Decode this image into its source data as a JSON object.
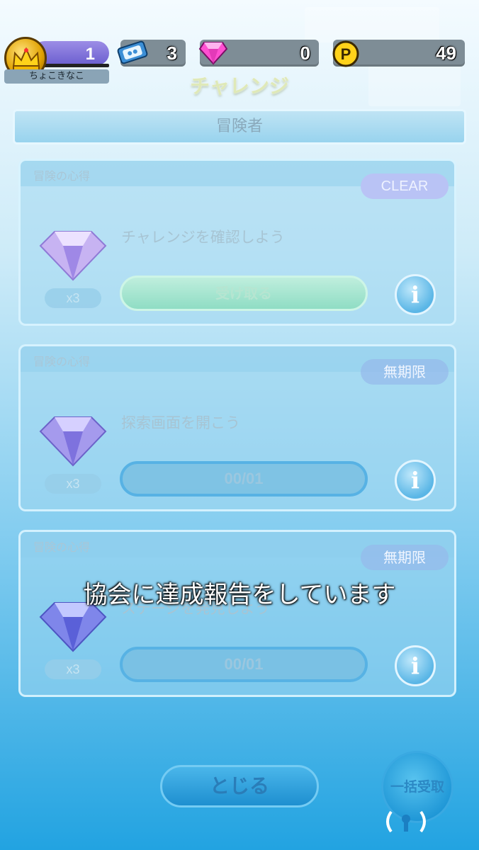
{
  "player": {
    "level": "1",
    "name": "ちょこきなこ"
  },
  "resources": {
    "tickets": "3",
    "gems": "0",
    "points": "49"
  },
  "title": "チャレンジ",
  "tab_label": "冒険者",
  "cards": [
    {
      "category": "冒険の心得",
      "badge": "CLEAR",
      "task": "チャレンジを確認しよう",
      "qty": "x3",
      "action_label": "受け取る"
    },
    {
      "category": "冒険の心得",
      "badge": "無期限",
      "task": "探索画面を開こう",
      "qty": "x3",
      "progress": "00/01"
    },
    {
      "category": "冒険の心得",
      "badge": "無期限",
      "task": "ステージを発見しよう",
      "qty": "x3",
      "progress": "00/01"
    }
  ],
  "overlay_message": "協会に達成報告をしています",
  "buttons": {
    "close": "とじる",
    "bulk_claim": "一括受取"
  },
  "colors": {
    "accent": "#22a3e1",
    "clear_badge": "#b9c3f5",
    "claim_button": "#8fddc4"
  },
  "icons": [
    "crown-icon",
    "ticket-icon",
    "gem-icon",
    "p-coin-icon",
    "info-icon",
    "signal-icon"
  ]
}
